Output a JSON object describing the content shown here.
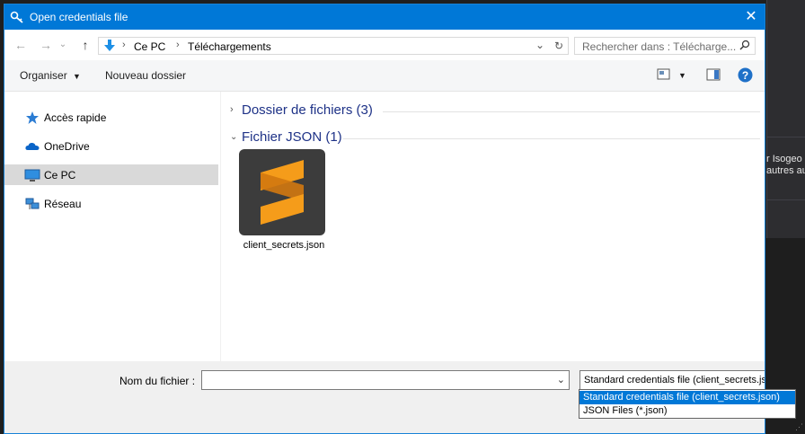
{
  "background_app": {
    "text_line1": "r Isogeo",
    "text_line2": "autres au"
  },
  "dialog": {
    "title": "Open credentials file",
    "close_label": "✕"
  },
  "nav": {
    "back": "←",
    "forward": "→",
    "history": "⌄",
    "up": "↑",
    "breadcrumb": [
      "Ce PC",
      "Téléchargements"
    ],
    "breadcrumb_sep": "›",
    "search_placeholder": "Rechercher dans : Télécharge..."
  },
  "toolbar": {
    "organize_label": "Organiser",
    "new_folder_label": "Nouveau dossier"
  },
  "sidebar": {
    "items": [
      {
        "label": "Accès rapide",
        "icon": "star-icon",
        "selected": false
      },
      {
        "label": "OneDrive",
        "icon": "cloud-icon",
        "selected": false
      },
      {
        "label": "Ce PC",
        "icon": "computer-icon",
        "selected": true
      },
      {
        "label": "Réseau",
        "icon": "network-icon",
        "selected": false
      }
    ]
  },
  "content": {
    "groups": [
      {
        "title": "Dossier de fichiers (3)",
        "expanded": false
      },
      {
        "title": "Fichier JSON (1)",
        "expanded": true
      }
    ],
    "files": [
      {
        "name": "client_secrets.json",
        "icon": "sublime-text-icon"
      }
    ]
  },
  "bottom": {
    "filename_label": "Nom du fichier :",
    "filename_value": "",
    "filetype_selected": "Standard credentials file  (client_secrets.json)",
    "filetype_options": [
      "Standard credentials file  (client_secrets.json)",
      "JSON Files (*.json)"
    ]
  },
  "colors": {
    "accent": "#0078d7",
    "group_title": "#1e3287",
    "selected_nav": "#d9d9d9",
    "icon_orange": "#f59c1a"
  }
}
